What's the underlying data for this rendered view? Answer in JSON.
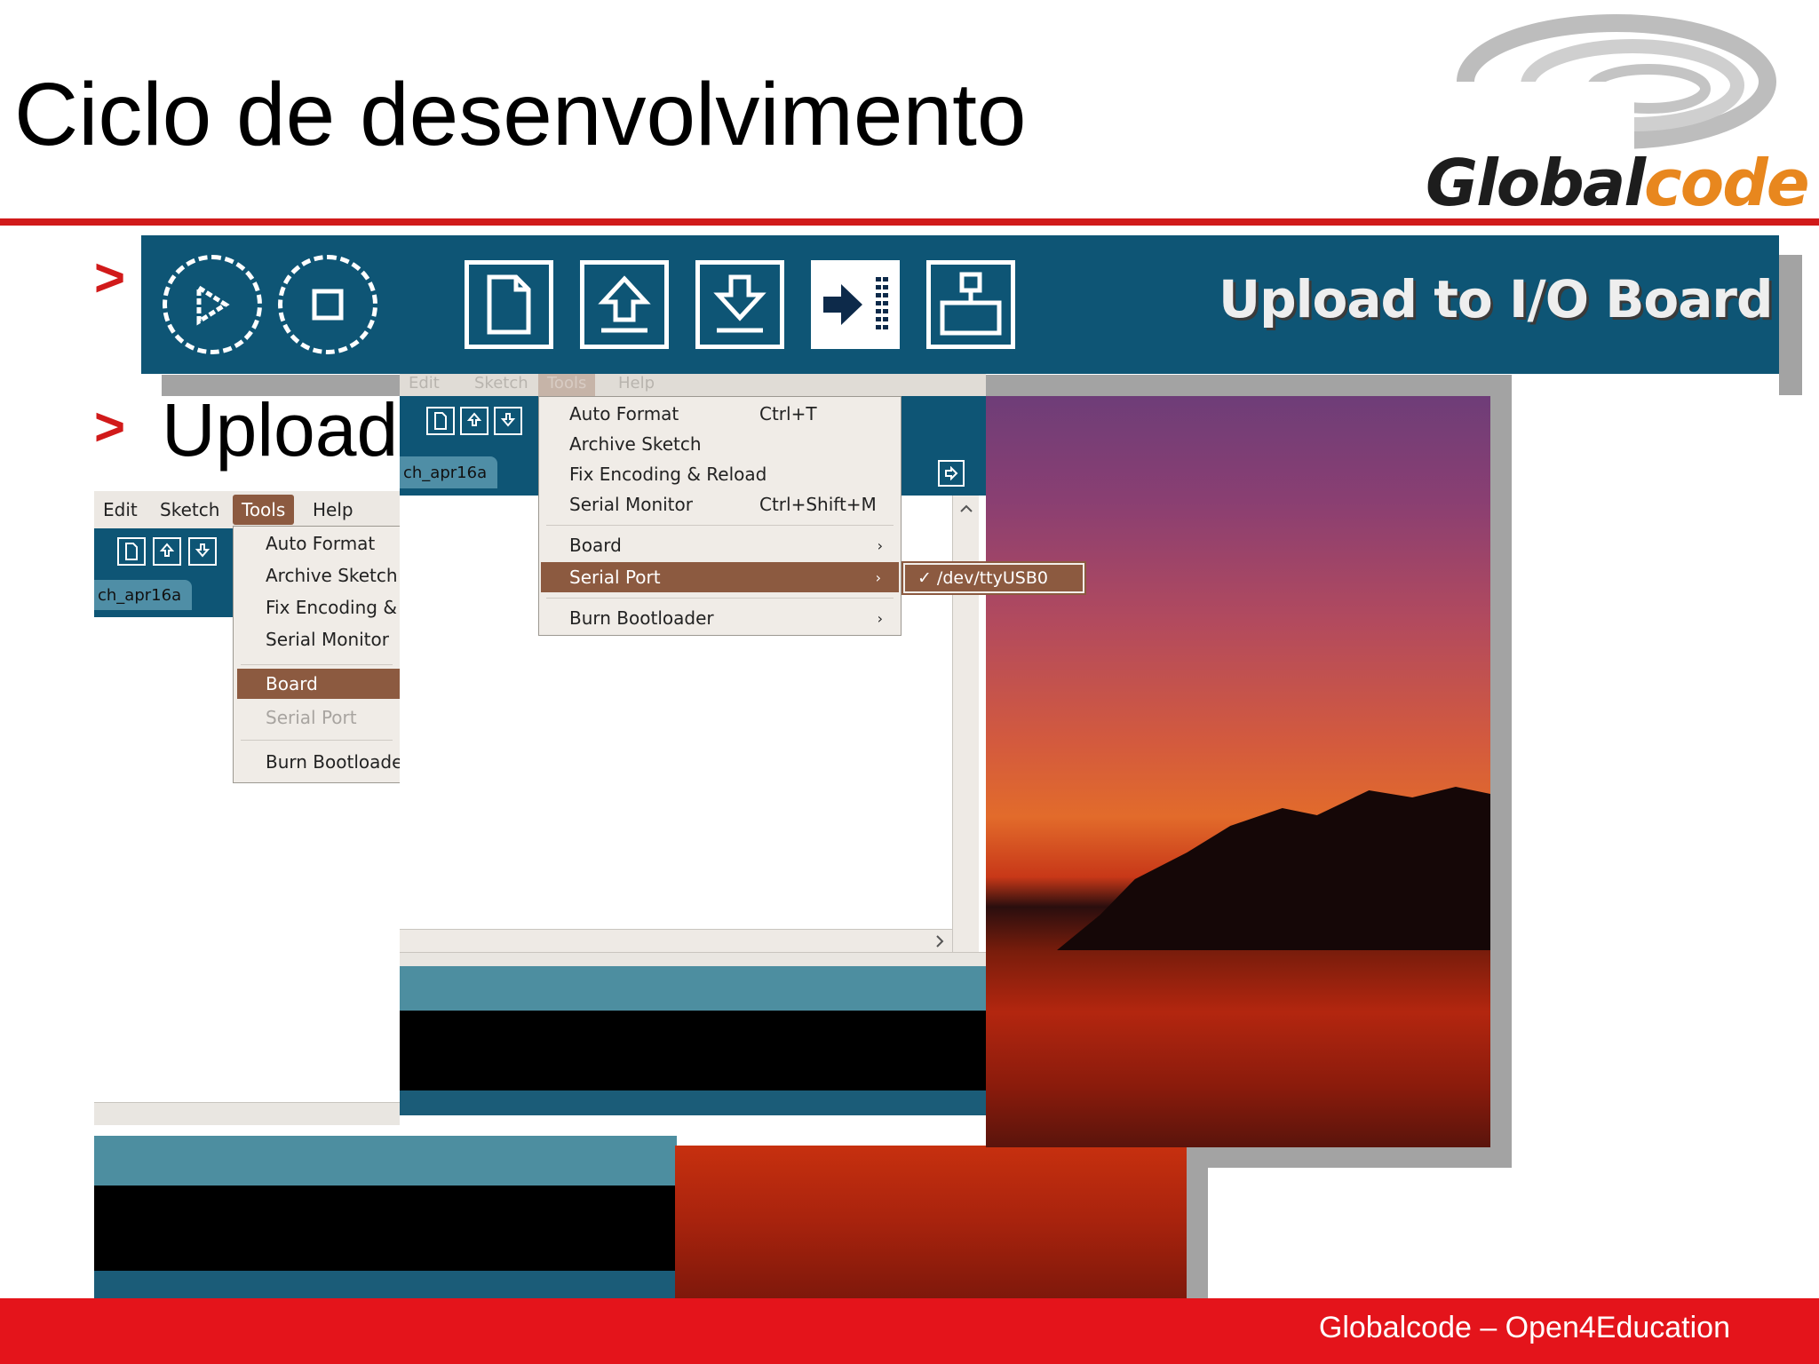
{
  "slide": {
    "title": "Ciclo de desenvolvimento",
    "bullets": [
      {
        "marker": ">",
        "text": ""
      },
      {
        "marker": ">",
        "text": "Upload"
      }
    ],
    "logo": {
      "part1": "Global",
      "part2": "code"
    },
    "footer": "Globalcode – Open4Education"
  },
  "toolbar_banner": {
    "label": "Upload to I/O Board",
    "buttons": [
      "play-icon",
      "stop-icon",
      "new-file-icon",
      "open-icon",
      "save-icon",
      "upload-icon",
      "serial-monitor-icon"
    ]
  },
  "front_window": {
    "menubar": [
      "Edit",
      "Sketch",
      "Tools",
      "Help"
    ],
    "tab_label": "ch_apr16a",
    "tools_menu": {
      "items": [
        {
          "label": "Auto Format",
          "shortcut": "Ctrl+T"
        },
        {
          "label": "Archive Sketch",
          "shortcut": ""
        },
        {
          "label": "Fix Encoding & Reload",
          "shortcut": ""
        },
        {
          "label": "Serial Monitor",
          "shortcut": "Ctrl+Shift+M"
        },
        {
          "label": "Board",
          "arrow": "›"
        },
        {
          "label": "Serial Port",
          "arrow": "›"
        },
        {
          "label": "Burn Bootloader",
          "arrow": "›"
        }
      ]
    },
    "serial_submenu": {
      "check": "✓",
      "item": "/dev/ttyUSB0"
    }
  },
  "back_window": {
    "menubar": [
      "Edit",
      "Sketch",
      "Tools",
      "Help"
    ],
    "tab_label": "ch_apr16a",
    "tools_menu": {
      "items": [
        "Auto Format",
        "Archive Sketch",
        "Fix Encoding & F",
        "Serial Monitor",
        "Board",
        "Serial Port",
        "Burn Bootloader"
      ]
    }
  },
  "colors": {
    "accent_red": "#d11a1a",
    "ide_teal": "#0e5575",
    "menu_highlight": "#8c5a40",
    "logo_orange": "#e8871e"
  }
}
